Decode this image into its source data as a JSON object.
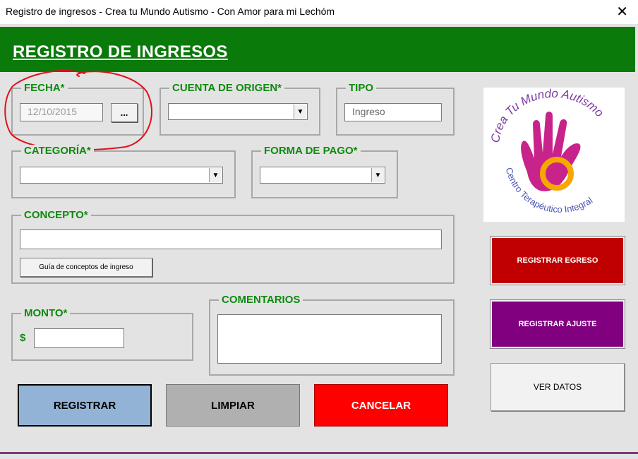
{
  "window": {
    "title": "Registro de ingresos - Crea tu Mundo Autismo - Con Amor para mi Lechóm",
    "close_glyph": "✕"
  },
  "header": {
    "title": "REGISTRO DE INGRESOS"
  },
  "fecha": {
    "label": "FECHA*",
    "value": "12/10/2015",
    "picker_label": "..."
  },
  "cuenta_origen": {
    "label": "CUENTA DE ORIGEN*",
    "value": ""
  },
  "tipo": {
    "label": "TIPO",
    "value": "Ingreso"
  },
  "categoria": {
    "label": "CATEGORÍA*",
    "value": ""
  },
  "forma_pago": {
    "label": "FORMA DE PAGO*",
    "value": ""
  },
  "concepto": {
    "label": "CONCEPTO*",
    "value": "",
    "guide_button": "Guía de conceptos de ingreso"
  },
  "monto": {
    "label": "MONTO*",
    "currency": "$",
    "value": ""
  },
  "comentarios": {
    "label": "COMENTARIOS",
    "value": ""
  },
  "buttons": {
    "registrar": "REGISTRAR",
    "limpiar": "LIMPIAR",
    "cancelar": "CANCELAR",
    "registrar_egreso": "REGISTRAR EGRESO",
    "registrar_ajuste": "REGISTRAR AJUSTE",
    "ver_datos": "VER DATOS"
  },
  "logo": {
    "line1": "Crea Tu Mundo Autismo",
    "line2": "Centro Terapéutico Integral"
  },
  "colors": {
    "header_green": "#0a7a0a",
    "legend_green": "#0d8a0d",
    "registrar_bg": "#93b3d6",
    "limpiar_bg": "#b0b0b0",
    "cancelar_bg": "#ff0000",
    "egreso_bg": "#c00000",
    "ajuste_bg": "#800080",
    "ver_datos_bg": "#f2f2f2",
    "annotation_red": "#e0101a"
  }
}
